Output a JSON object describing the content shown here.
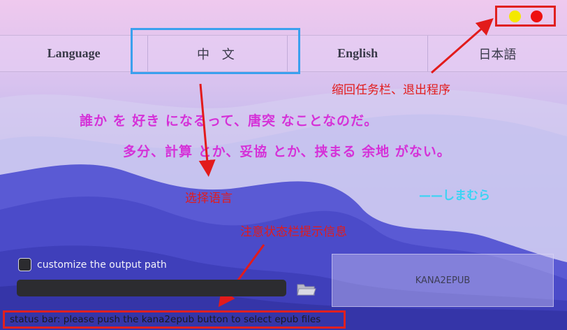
{
  "language_tabs": [
    {
      "label": "Language"
    },
    {
      "label": "中 文"
    },
    {
      "label": "English"
    },
    {
      "label": "日本語"
    }
  ],
  "window_controls": {
    "minimize_color": "#f4e800",
    "close_color": "#ee1010"
  },
  "annotations": {
    "window_controls_note": "缩回任务栏、退出程序",
    "language_note": "选择语言",
    "status_note": "注意状态栏提示信息",
    "highlight_color": "#3ba0ee",
    "note_color": "#e21b1b"
  },
  "quote": {
    "line1": "誰か を 好き になるって、唐突 なことなのだ。",
    "line2": "多分、計算 とか、妥協 とか、挟まる 余地 がない。",
    "signature": "——しまむら",
    "color": "#d531d8",
    "signature_color": "#39d4f4"
  },
  "options": {
    "customize_label": "customize the output path",
    "customize_checked": false,
    "output_path_value": ""
  },
  "main_button": {
    "label": "KANA2EPUB"
  },
  "status_bar": {
    "text": "status bar:   please push the kana2epub button to select epub files"
  },
  "icons": {
    "folder": "folder-icon",
    "minimize": "minimize-dot",
    "close": "close-dot"
  }
}
